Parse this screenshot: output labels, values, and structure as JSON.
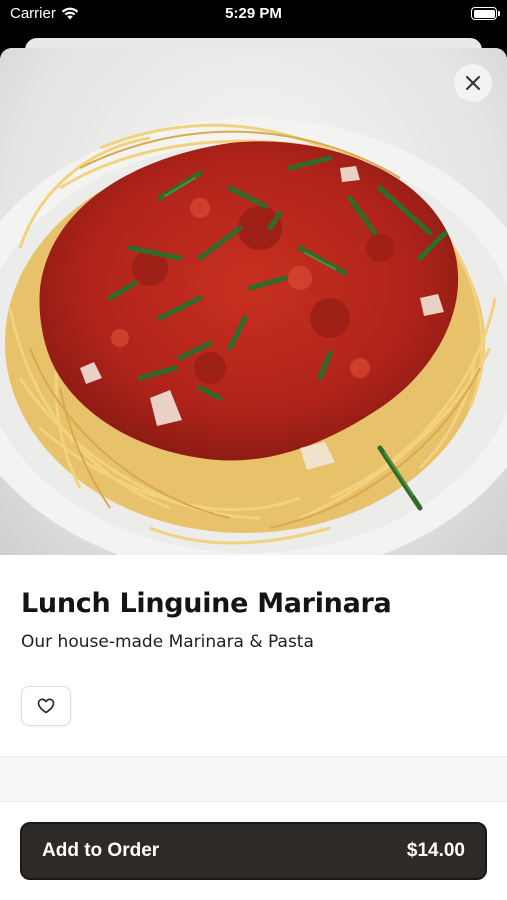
{
  "status_bar": {
    "carrier": "Carrier",
    "time": "5:29 PM"
  },
  "item": {
    "title": "Lunch Linguine Marinara",
    "description": "Our house-made Marinara & Pasta",
    "image_alt": "Plate of linguine with marinara sauce and fresh basil"
  },
  "actions": {
    "add_label": "Add to Order",
    "price": "$14.00"
  },
  "icons": {
    "close": "close-icon",
    "favorite": "heart-icon",
    "wifi": "wifi-icon",
    "battery": "battery-icon"
  },
  "colors": {
    "primary_button": "#2d2a28",
    "sauce": "#b8261a",
    "basil": "#2f6b2a"
  }
}
